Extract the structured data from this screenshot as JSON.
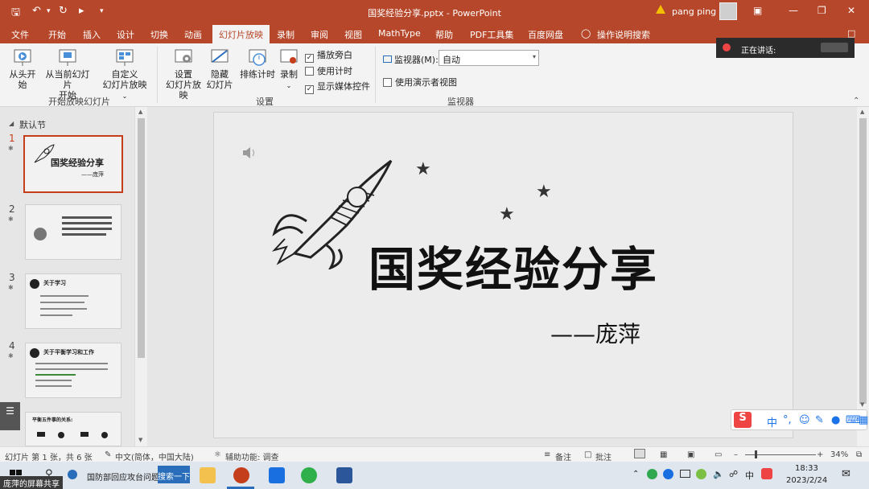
{
  "window": {
    "title": "国奖经验分享.pptx - PowerPoint",
    "user": "pang ping"
  },
  "tabs": [
    "文件",
    "开始",
    "插入",
    "设计",
    "切换",
    "动画",
    "幻灯片放映",
    "录制",
    "审阅",
    "视图",
    "MathType",
    "帮助",
    "PDF工具集",
    "百度网盘",
    "操作说明搜索"
  ],
  "ribbon": {
    "from_start": "从头开始",
    "from_current_1": "从当前幻灯片",
    "from_current_2": "开始",
    "custom_1": "自定义",
    "custom_2": "幻灯片放映",
    "group1": "开始放映幻灯片",
    "setup_1": "设置",
    "setup_2": "幻灯片放映",
    "hide_1": "隐藏",
    "hide_2": "幻灯片",
    "rehearse": "排练计时",
    "record": "录制",
    "cb_narration": "播放旁白",
    "cb_timing": "使用计时",
    "cb_media": "显示媒体控件",
    "group2": "设置",
    "monitor_label": "监视器(M):",
    "monitor_value": "自动",
    "presenter_view": "使用演示者视图",
    "group3": "监视器"
  },
  "toast": {
    "text": "正在讲话:"
  },
  "panel": {
    "section": "默认节",
    "slides": [
      {
        "num": "1",
        "title": "国奖经验分享",
        "sub": "——庞萍"
      },
      {
        "num": "2"
      },
      {
        "num": "3",
        "title": "关于学习"
      },
      {
        "num": "4",
        "title": "关于平衡学习和工作"
      },
      {
        "num": "5",
        "title": "平衡五件事的关系:"
      }
    ]
  },
  "slide": {
    "title": "国奖经验分享",
    "subtitle": "——庞萍"
  },
  "status": {
    "slide_count": "幻灯片 第 1 张，共 6 张",
    "language": "中文(简体，中国大陆)",
    "accessibility": "辅助功能: 调查",
    "notes": "备注",
    "comments": "批注",
    "zoom": "34%"
  },
  "taskbar": {
    "search_text": "国防部回应攻台问题",
    "search_button": "搜索一下",
    "time": "18:33",
    "date": "2023/2/24",
    "ime_lang": "中"
  },
  "share_label": "庞萍的屏幕共享"
}
